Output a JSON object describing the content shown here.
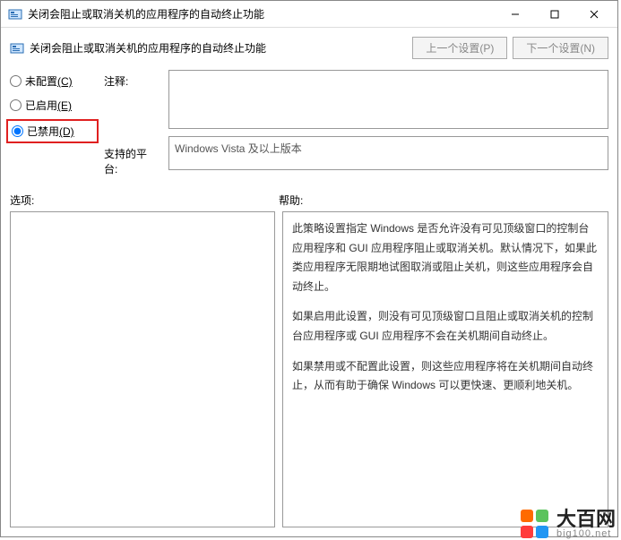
{
  "title": "关闭会阻止或取消关机的应用程序的自动终止功能",
  "header": {
    "title": "关闭会阻止或取消关机的应用程序的自动终止功能",
    "prev_btn": "上一个设置(P)",
    "next_btn": "下一个设置(N)"
  },
  "radios": {
    "not_configured": {
      "label": "未配置",
      "mnemonic": "(C)"
    },
    "enabled": {
      "label": "已启用",
      "mnemonic": "(E)"
    },
    "disabled": {
      "label": "已禁用",
      "mnemonic": "(D)"
    }
  },
  "labels": {
    "comment": "注释:",
    "platform": "支持的平台:",
    "options": "选项:",
    "help": "帮助:"
  },
  "fields": {
    "comment_value": "",
    "platform_value": "Windows Vista 及以上版本"
  },
  "help": {
    "p1": "此策略设置指定 Windows 是否允许没有可见顶级窗口的控制台应用程序和 GUI 应用程序阻止或取消关机。默认情况下，如果此类应用程序无限期地试图取消或阻止关机，则这些应用程序会自动终止。",
    "p2": "如果启用此设置，则没有可见顶级窗口且阻止或取消关机的控制台应用程序或 GUI 应用程序不会在关机期间自动终止。",
    "p3": "如果禁用或不配置此设置，则这些应用程序将在关机期间自动终止，从而有助于确保 Windows 可以更快速、更顺利地关机。"
  },
  "watermark": {
    "name": "大百网",
    "url": "big100.net"
  }
}
